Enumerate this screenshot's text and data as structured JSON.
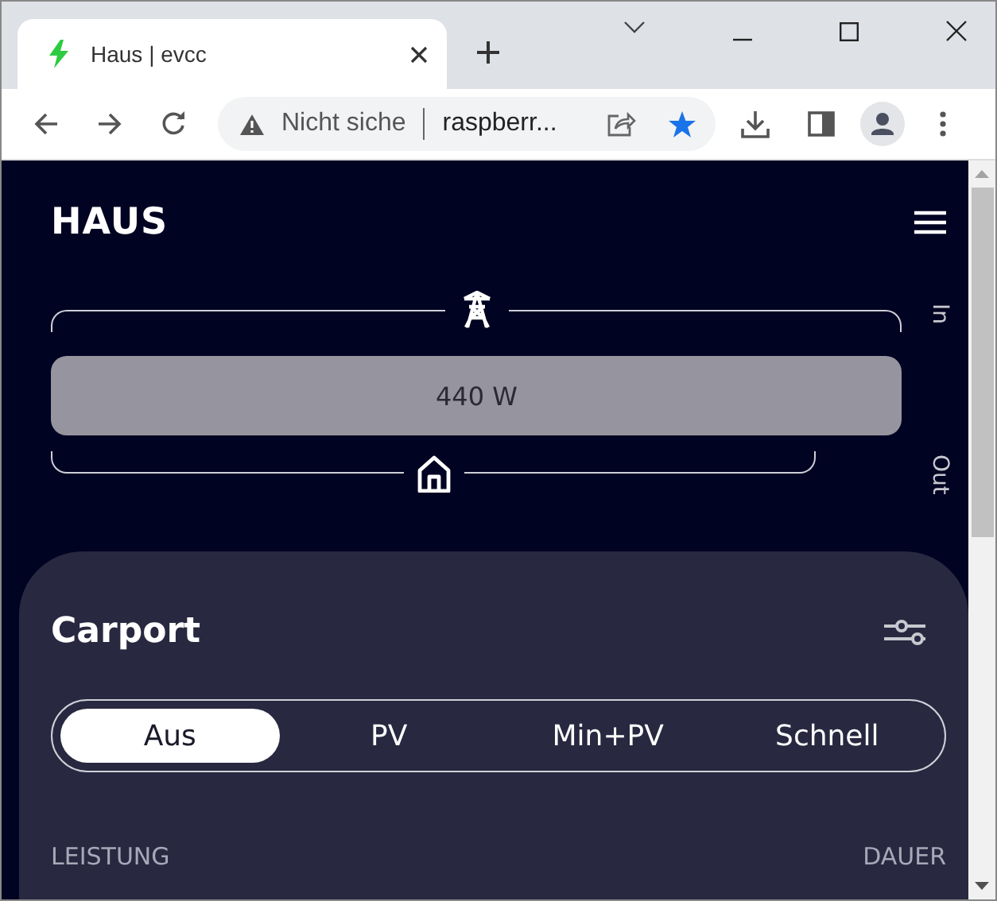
{
  "browser": {
    "tab": {
      "title": "Haus | evcc"
    },
    "address_bar": {
      "security": "Nicht siche",
      "url": "raspberr..."
    }
  },
  "header": {
    "title": "HAUS"
  },
  "energy_flow": {
    "bar_value": "440 W",
    "in_label": "In",
    "out_label": "Out"
  },
  "loadpoint": {
    "title": "Carport",
    "modes": [
      {
        "label": "Aus",
        "selected": true
      },
      {
        "label": "PV",
        "selected": false
      },
      {
        "label": "Min+PV",
        "selected": false
      },
      {
        "label": "Schnell",
        "selected": false
      }
    ],
    "labels": [
      "LEISTUNG",
      "DAUER"
    ]
  }
}
